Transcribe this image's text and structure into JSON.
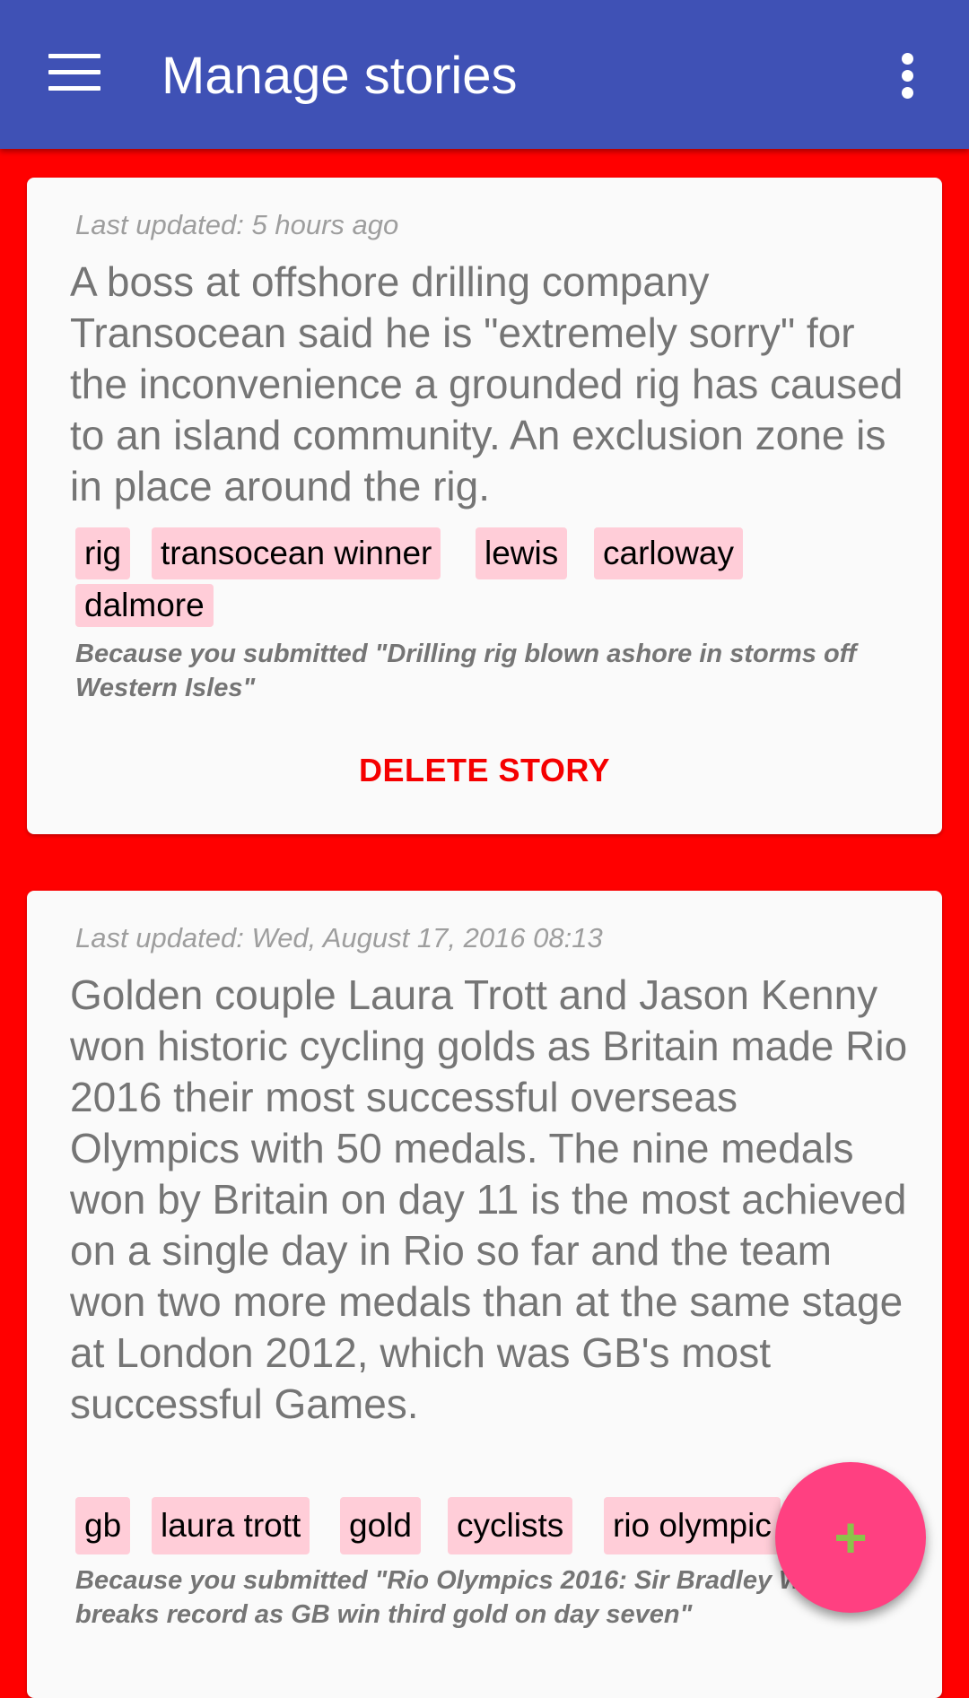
{
  "appbar": {
    "title": "Manage stories",
    "menu_icon": "hamburger-menu-icon",
    "overflow_icon": "more-vertical-icon",
    "color": "#3f51b5"
  },
  "background_color": "#ff0000",
  "stories": [
    {
      "last_updated": "Last updated: 5 hours ago",
      "text": "A boss at offshore drilling company Transocean said he is \"extremely sorry\" for the inconvenience a grounded rig has caused to an island community. An exclusion zone is in place around the rig.",
      "tags": [
        "rig",
        "transocean winner",
        "lewis",
        "carloway",
        "dalmore"
      ],
      "because": "Because you submitted \"Drilling rig blown ashore in storms off Western Isles\"",
      "delete_label": "DELETE STORY"
    },
    {
      "last_updated": "Last updated: Wed, August 17, 2016 08:13",
      "text": "Golden couple Laura Trott and Jason Kenny won historic cycling golds as Britain made Rio 2016 their most successful overseas Olympics with 50 medals. The nine medals won by Britain on day 11 is the most achieved on a single day in Rio so far and the team won two more medals than at the same stage at London 2012, which was GB's most successful Games.",
      "tags": [
        "gb",
        "laura trott",
        "gold",
        "cyclists",
        "rio olympic"
      ],
      "because": "Because you submitted \"Rio Olympics 2016: Sir Bradley Wiggins breaks record as GB win third gold on day seven\""
    }
  ],
  "fab": {
    "icon": "plus-icon",
    "color": "#ff4081",
    "icon_color": "#8bc34a",
    "label": "+"
  },
  "colors": {
    "tag_background": "#ffcdd8",
    "delete_text": "#f50000"
  }
}
